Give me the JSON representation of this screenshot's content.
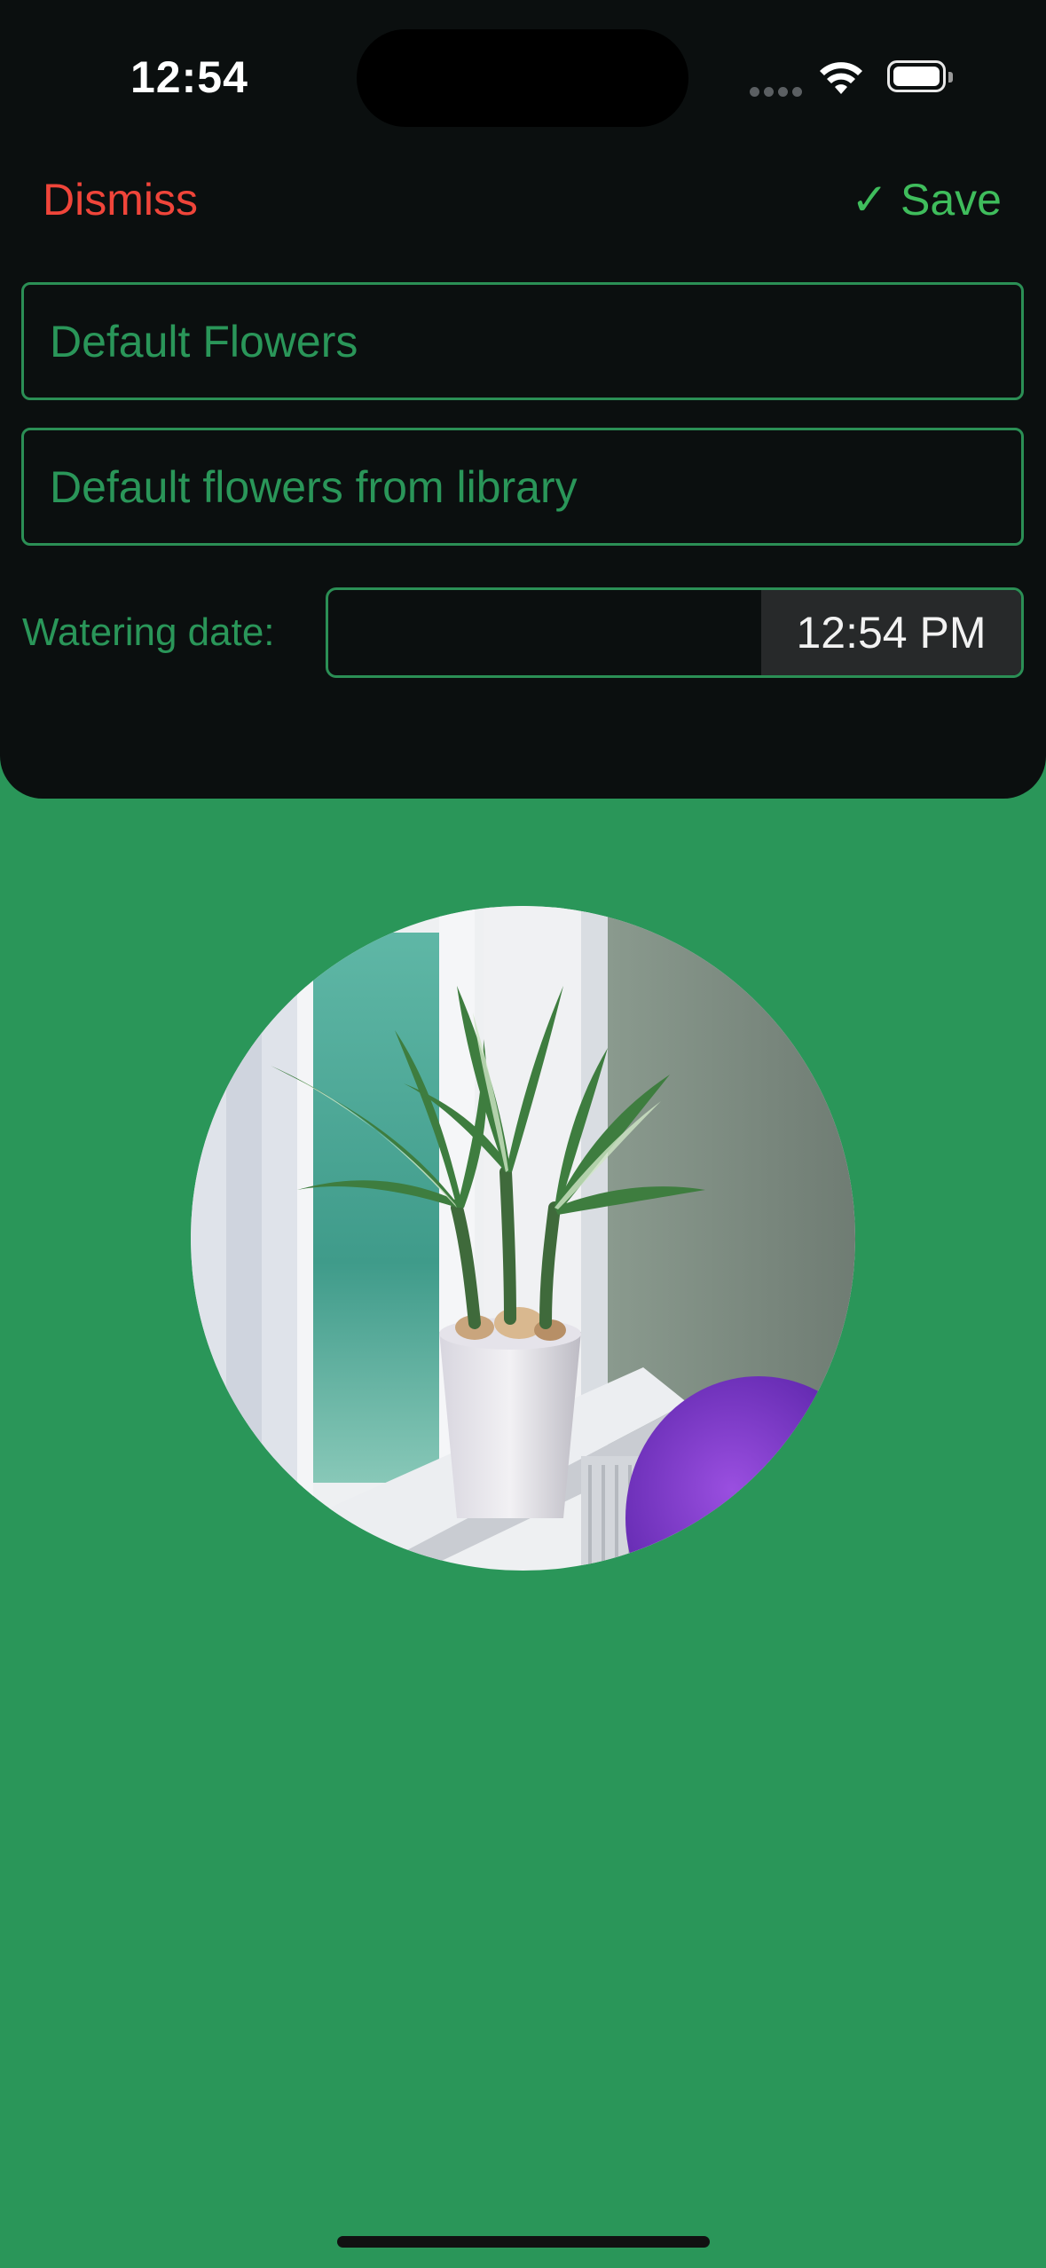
{
  "status_bar": {
    "time": "12:54",
    "icons": [
      "cellular-signal-icon",
      "wifi-icon",
      "battery-icon"
    ]
  },
  "toolbar": {
    "dismiss_label": "Dismiss",
    "save_label": "✓ Save"
  },
  "form": {
    "name_value": "Default Flowers",
    "description_value": "Default flowers from library",
    "watering_label": "Watering date:",
    "watering_time": "12:54 PM"
  },
  "photo": {
    "subject": "potted plant on windowsill"
  },
  "colors": {
    "background_green": "#2a9659",
    "sheet_black": "#0b0f0f",
    "dismiss_red": "#f0453a",
    "save_green": "#3fbd5c",
    "field_border": "#2b8f55"
  }
}
